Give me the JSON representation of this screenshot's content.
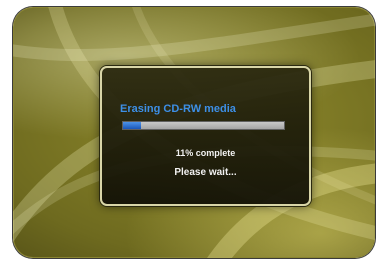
{
  "dialog": {
    "title": "Erasing CD-RW media",
    "progress_fraction": 0.11,
    "progress_text": "11% complete",
    "status_text": "Please wait..."
  },
  "colors": {
    "title": "#3d8fe6",
    "progress_fill": "#1a56b8",
    "background_tint": "#6e6a1f"
  }
}
